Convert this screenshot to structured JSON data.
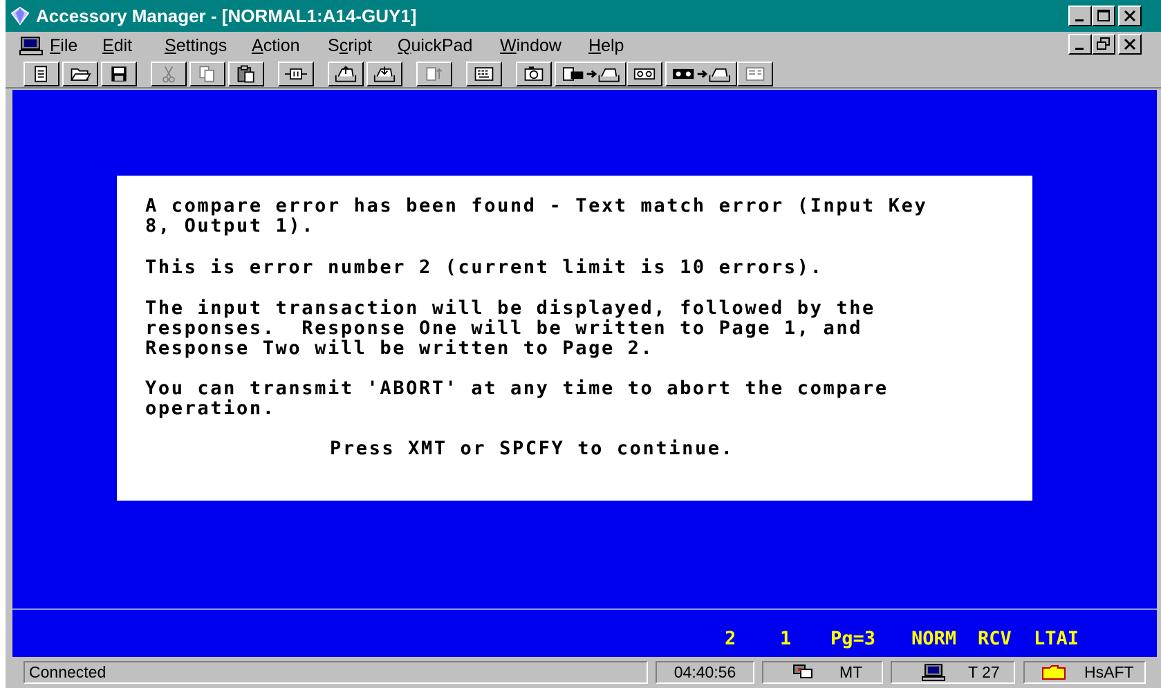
{
  "window": {
    "title": "Accessory Manager - [NORMAL1:A14-GUY1]"
  },
  "menu": {
    "items": [
      {
        "label": "File",
        "u": "F",
        "rest": "ile"
      },
      {
        "label": "Edit",
        "u": "E",
        "rest": "dit"
      },
      {
        "label": "Settings",
        "u": "S",
        "rest": "ettings"
      },
      {
        "label": "Action",
        "u": "A",
        "rest": "ction"
      },
      {
        "label": "Script",
        "pre": "S",
        "u": "c",
        "rest": "ript"
      },
      {
        "label": "QuickPad",
        "u": "Q",
        "rest": "uickPad"
      },
      {
        "label": "Window",
        "u": "W",
        "rest": "indow"
      },
      {
        "label": "Help",
        "u": "H",
        "rest": "elp"
      }
    ]
  },
  "toolbar": {
    "buttons": [
      "new-doc-icon",
      "open-folder-icon",
      "save-disk-icon",
      "cut-icon",
      "copy-icon",
      "paste-icon",
      "transmit-icon",
      "send-tray-icon",
      "receive-tray-icon",
      "page-up-icon",
      "keyboard-icon",
      "camera-icon",
      "capture-to-tray-icon",
      "tape-icon",
      "record-to-tray-icon",
      "screen-icon"
    ]
  },
  "dialog": {
    "lines": [
      "A compare error has been found - Text match error (Input Key",
      "8, Output 1).",
      "This is error number 2 (current limit is 10 errors).",
      "The input transaction will be displayed, followed by the",
      "responses.  Response One will be written to Page 1, and",
      "Response Two will be written to Page 2.",
      "You can transmit 'ABORT' at any time to abort the compare",
      "operation.",
      "Press XMT or SPCFY to continue."
    ]
  },
  "terminal_status": {
    "col1": "2",
    "col2": "1",
    "page": "Pg=3",
    "mode": "NORM",
    "rcv": "RCV",
    "ltai": "LTAI"
  },
  "statusbar": {
    "connection": "Connected",
    "time": "04:40:56",
    "mt": "MT",
    "terminal": "T 27",
    "hsaft": "HsAFT"
  },
  "colors": {
    "titlebar": "#008080",
    "terminal_bg": "#0000f0",
    "status_text": "#ffff00"
  }
}
